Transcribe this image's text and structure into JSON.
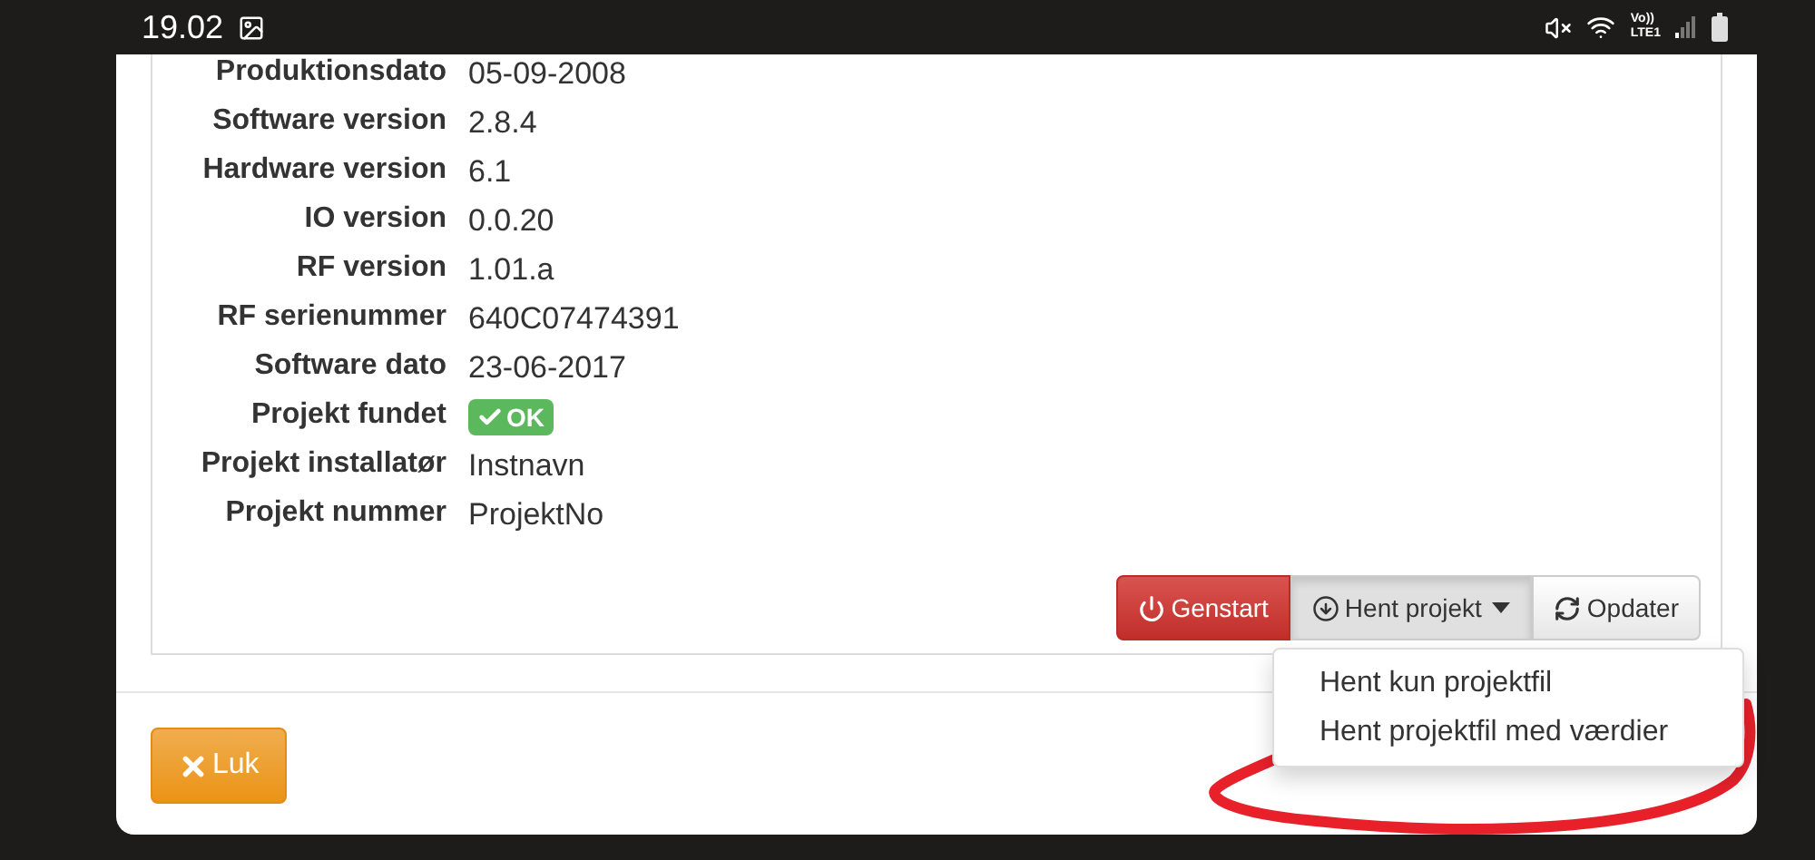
{
  "status_bar": {
    "time": "19.02",
    "network_lines": [
      "Vo))",
      "LTE1"
    ]
  },
  "info": [
    {
      "label": "Produktionsdato",
      "value": "05-09-2008"
    },
    {
      "label": "Software version",
      "value": "2.8.4"
    },
    {
      "label": "Hardware version",
      "value": "6.1"
    },
    {
      "label": "IO version",
      "value": "0.0.20"
    },
    {
      "label": "RF version",
      "value": "1.01.a"
    },
    {
      "label": "RF serienummer",
      "value": "640C07474391"
    },
    {
      "label": "Software dato",
      "value": "23-06-2017"
    },
    {
      "label": "Projekt fundet",
      "value": "OK",
      "kind": "badge"
    },
    {
      "label": "Projekt installatør",
      "value": "Instnavn"
    },
    {
      "label": "Projekt nummer",
      "value": "ProjektNo"
    }
  ],
  "actions": [
    {
      "label": "Genstart",
      "kind": "danger"
    },
    {
      "label": "Hent projekt",
      "kind": "dropdown",
      "expanded": true
    },
    {
      "label": "Opdater",
      "kind": "default"
    }
  ],
  "dropdown_items": [
    "Hent kun projektfil",
    "Hent projektfil med værdier"
  ],
  "close_button": "Luk"
}
